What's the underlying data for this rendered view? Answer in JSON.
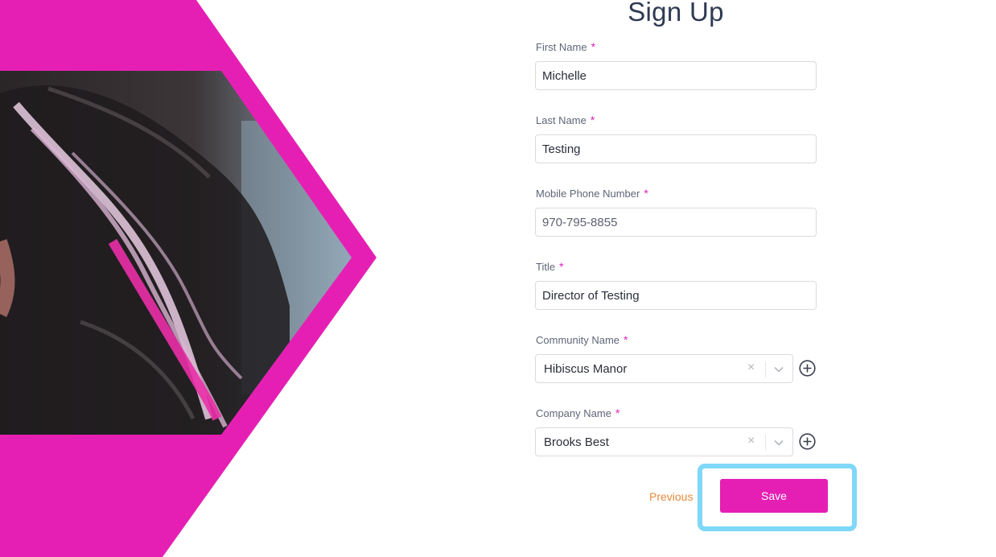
{
  "form": {
    "title": "Sign Up",
    "required_marker": "*",
    "fields": {
      "first_name": {
        "label": "First Name",
        "value": "Michelle"
      },
      "last_name": {
        "label": "Last Name",
        "value": "Testing"
      },
      "mobile_phone": {
        "label": "Mobile Phone Number",
        "placeholder": "970-795-8855"
      },
      "title": {
        "label": "Title",
        "value": "Director of Testing"
      },
      "community_name": {
        "label": "Community Name",
        "value": "Hibiscus Manor",
        "clear_glyph": "×"
      },
      "company_name": {
        "label": "Company Name",
        "value": "Brooks Best",
        "clear_glyph": "×"
      }
    },
    "actions": {
      "previous_label": "Previous",
      "save_label": "Save"
    }
  },
  "colors": {
    "brand_pink": "#e51fb4",
    "previous_link": "#e98a3c",
    "focus_ring": "#7fd8f8",
    "title_text": "#2f3a52"
  },
  "icons": [
    "chevron-down-icon",
    "plus-circle-icon",
    "clear-icon"
  ]
}
